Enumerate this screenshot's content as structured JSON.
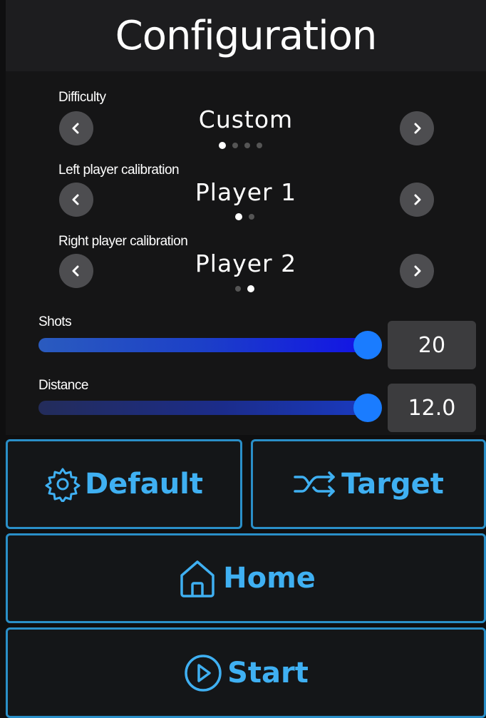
{
  "header": {
    "title": "Configuration"
  },
  "selectors": [
    {
      "label": "Difficulty",
      "value": "Custom",
      "dot_count": 4,
      "active_dot": 0
    },
    {
      "label": "Left player calibration",
      "value": "Player 1",
      "dot_count": 2,
      "active_dot": 0
    },
    {
      "label": "Right player calibration",
      "value": "Player 2",
      "dot_count": 2,
      "active_dot": 1
    }
  ],
  "sliders": [
    {
      "label": "Shots",
      "value": "20",
      "level": 1.0
    },
    {
      "label": "Distance",
      "value": "12.0",
      "level": 1.0
    }
  ],
  "buttons": {
    "default_label": "Default",
    "target_label": "Target",
    "home_label": "Home",
    "start_label": "Start"
  },
  "icons": {
    "prev": "chevron-left-icon",
    "next": "chevron-right-icon",
    "default": "gear-icon",
    "target": "shuffle-icon",
    "home": "home-icon",
    "start": "play-circle-icon"
  },
  "colors": {
    "accent": "#3fb0f2",
    "border": "#2a8fc8",
    "slider_thumb": "#1a7cff",
    "arrow_button": "#4d4d50"
  }
}
